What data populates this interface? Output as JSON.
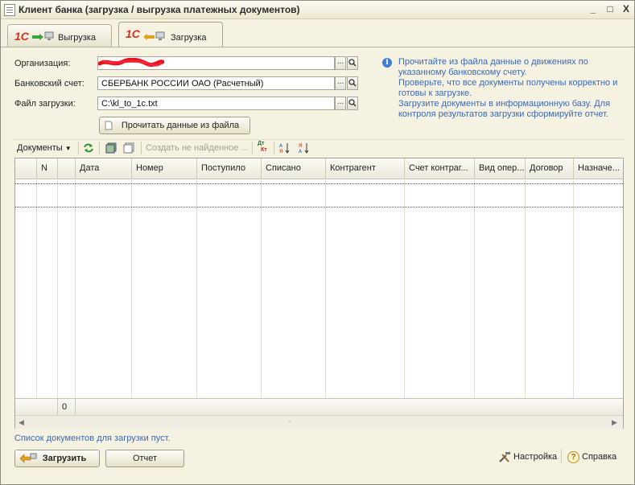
{
  "window": {
    "title": "Клиент банка (загрузка / выгрузка платежных документов)",
    "controls": [
      "_",
      "□",
      "X"
    ]
  },
  "tabs": [
    {
      "logo": "1С",
      "label": "Выгрузка",
      "active": false
    },
    {
      "logo": "1С",
      "label": "Загрузка",
      "active": true
    }
  ],
  "form": {
    "org_label": "Организация:",
    "org_value": "",
    "account_label": "Банковский счет:",
    "account_value": "СБЕРБАНК РОССИИ ОАО (Расчетный)",
    "file_label": "Файл загрузки:",
    "file_value": "C:\\kl_to_1c.txt",
    "dots": "...",
    "read_button": "Прочитать данные из файла"
  },
  "info": {
    "icon": "i",
    "lines": [
      "Прочитайте из файла данные о движениях по указанному банковскому счету.",
      "Проверьте, что все  документы получены корректно и готовы к загрузке.",
      "Загрузите документы в информационную базу. Для контроля результатов загрузки сформируйте отчет."
    ]
  },
  "toolbar": {
    "documents": "Документы",
    "create_missing": "Создать не найденное ...",
    "dtkt_top": "Дт",
    "dtkt_bottom": "Кт"
  },
  "table": {
    "columns": [
      "",
      "N",
      "Дата",
      "Номер",
      "Поступило",
      "Списано",
      "Контрагент",
      "Счет контраг...",
      "Вид опер...",
      "Договор",
      "Назначе..."
    ],
    "footer_count": "0"
  },
  "status_text": "Список документов для загрузки пуст.",
  "bottom": {
    "load_button": "Загрузить",
    "report_button": "Отчет",
    "settings": "Настройка",
    "help": "Справка",
    "help_icon": "?"
  },
  "colors": {
    "accent_text": "#3a69b8",
    "logo": "#d2331f",
    "window_bg": "#f5f2e2"
  }
}
